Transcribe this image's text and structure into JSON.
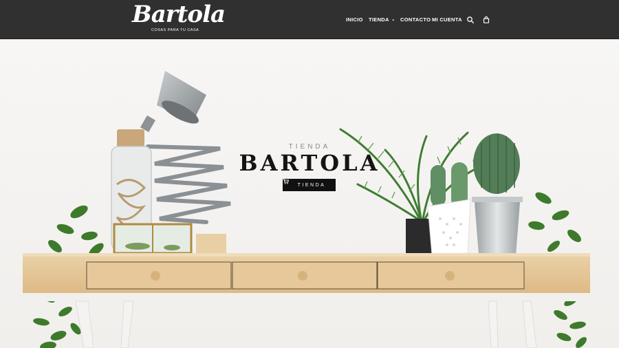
{
  "header": {
    "logo_script": "Bartola",
    "logo_tagline": "COSAS PARA TU CASA",
    "nav": [
      {
        "label": "INICIO"
      },
      {
        "label": "TIENDA"
      },
      {
        "label": "CONTACTO"
      },
      {
        "label": "MI CUENTA"
      }
    ],
    "icons": [
      "search-icon",
      "shopping-bag-icon"
    ]
  },
  "hero": {
    "kicker": "TIENDA",
    "title": "BARTOLA",
    "button_label": "TIENDA",
    "button_icon": "shopping-cart-icon"
  },
  "colors": {
    "header_bg": "#303030",
    "hero_bg": "#f6f5f3",
    "wood": "#e4c595",
    "button_bg": "#111111"
  }
}
